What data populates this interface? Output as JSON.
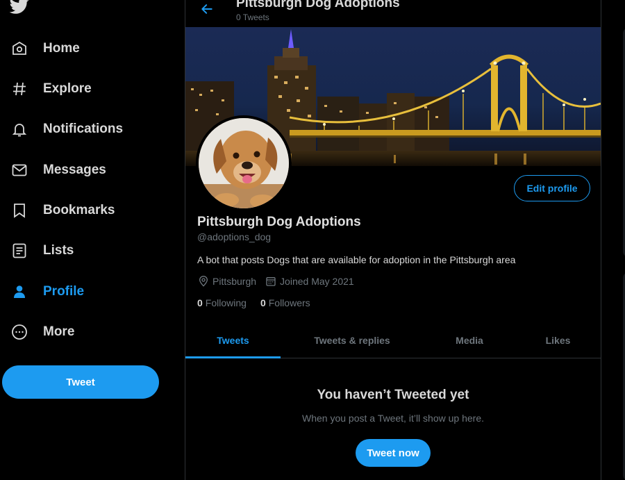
{
  "nav": {
    "items": [
      {
        "label": "Home",
        "icon": "home-icon"
      },
      {
        "label": "Explore",
        "icon": "hashtag-icon"
      },
      {
        "label": "Notifications",
        "icon": "bell-icon"
      },
      {
        "label": "Messages",
        "icon": "envelope-icon"
      },
      {
        "label": "Bookmarks",
        "icon": "bookmark-icon"
      },
      {
        "label": "Lists",
        "icon": "list-icon"
      },
      {
        "label": "Profile",
        "icon": "person-icon",
        "active": true
      },
      {
        "label": "More",
        "icon": "more-circle-icon"
      }
    ],
    "tweet_label": "Tweet"
  },
  "header": {
    "title": "Pittsburgh Dog Adoptions",
    "subtitle": "0 Tweets"
  },
  "profile": {
    "name": "Pittsburgh Dog Adoptions",
    "handle": "@adoptions_dog",
    "bio": "A bot that posts Dogs that are available for adoption in the Pittsburgh area",
    "location": "Pittsburgh",
    "joined": "Joined May 2021",
    "following_count": "0",
    "following_label": "Following",
    "followers_count": "0",
    "followers_label": "Followers",
    "edit_label": "Edit profile"
  },
  "tabs": [
    {
      "label": "Tweets",
      "active": true
    },
    {
      "label": "Tweets & replies"
    },
    {
      "label": "Media"
    },
    {
      "label": "Likes"
    }
  ],
  "empty": {
    "title": "You haven’t Tweeted yet",
    "subtitle": "When you post a Tweet, it’ll show up here.",
    "button": "Tweet now"
  },
  "colors": {
    "accent": "#1d9bf0",
    "background": "#000000",
    "border": "#2f3336",
    "muted_text": "#6e767d"
  }
}
